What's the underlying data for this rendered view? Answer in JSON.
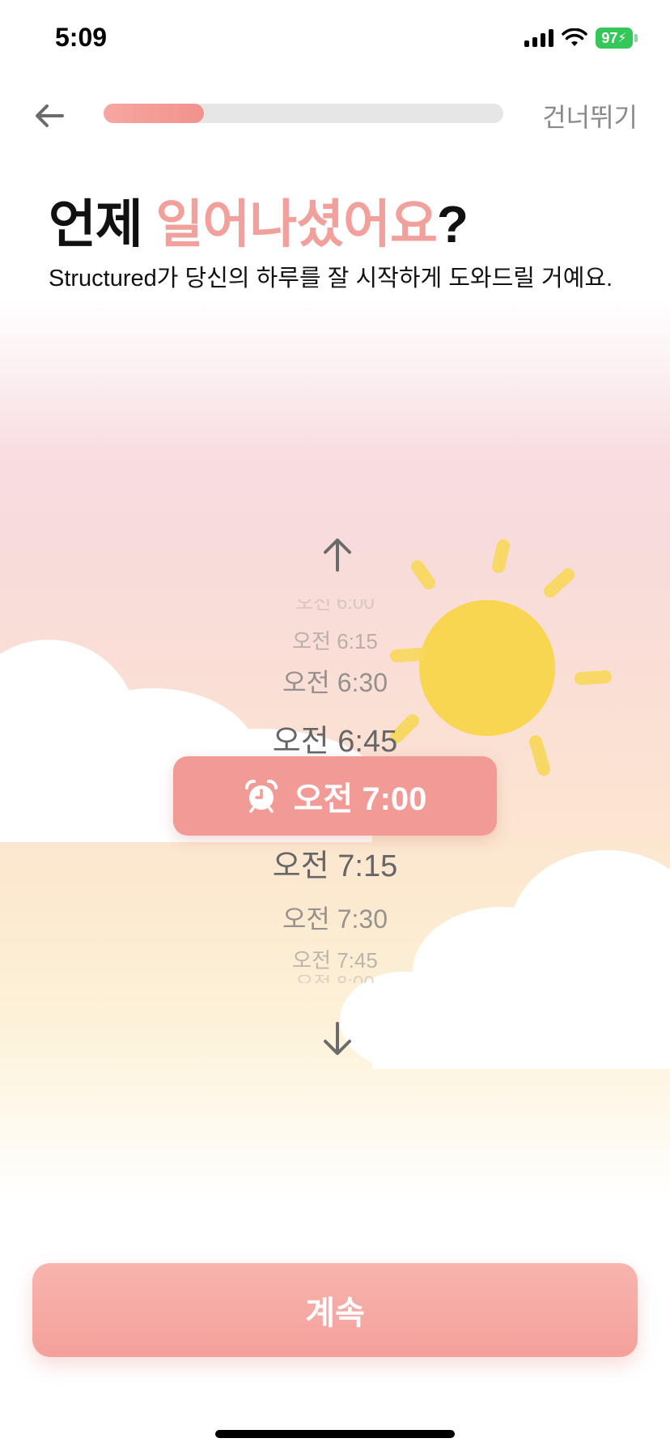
{
  "status_bar": {
    "time": "5:09",
    "battery": "97"
  },
  "header": {
    "progress": 0.25,
    "skip_label": "건너뛰기"
  },
  "title": {
    "part1": "언제 ",
    "accent": "일어나셨어요",
    "part2": "?"
  },
  "subtitle": "Structured가 당신의 하루를 잘 시작하게 도와드릴 거예요.",
  "picker": {
    "above": [
      "오전 6:00",
      "오전 6:15",
      "오전 6:30",
      "오전 6:45"
    ],
    "selected": "오전 7:00",
    "below": [
      "오전 7:15",
      "오전 7:30",
      "오전 7:45",
      "오전 8:00"
    ]
  },
  "continue_label": "계속",
  "colors": {
    "accent": "#f2a09c",
    "selected_bg": "#f29a96",
    "progress": "#f2928d"
  },
  "icons": [
    "back-arrow-icon",
    "arrow-up-icon",
    "arrow-down-icon",
    "alarm-clock-icon",
    "signal-icon",
    "wifi-icon",
    "battery-icon"
  ]
}
